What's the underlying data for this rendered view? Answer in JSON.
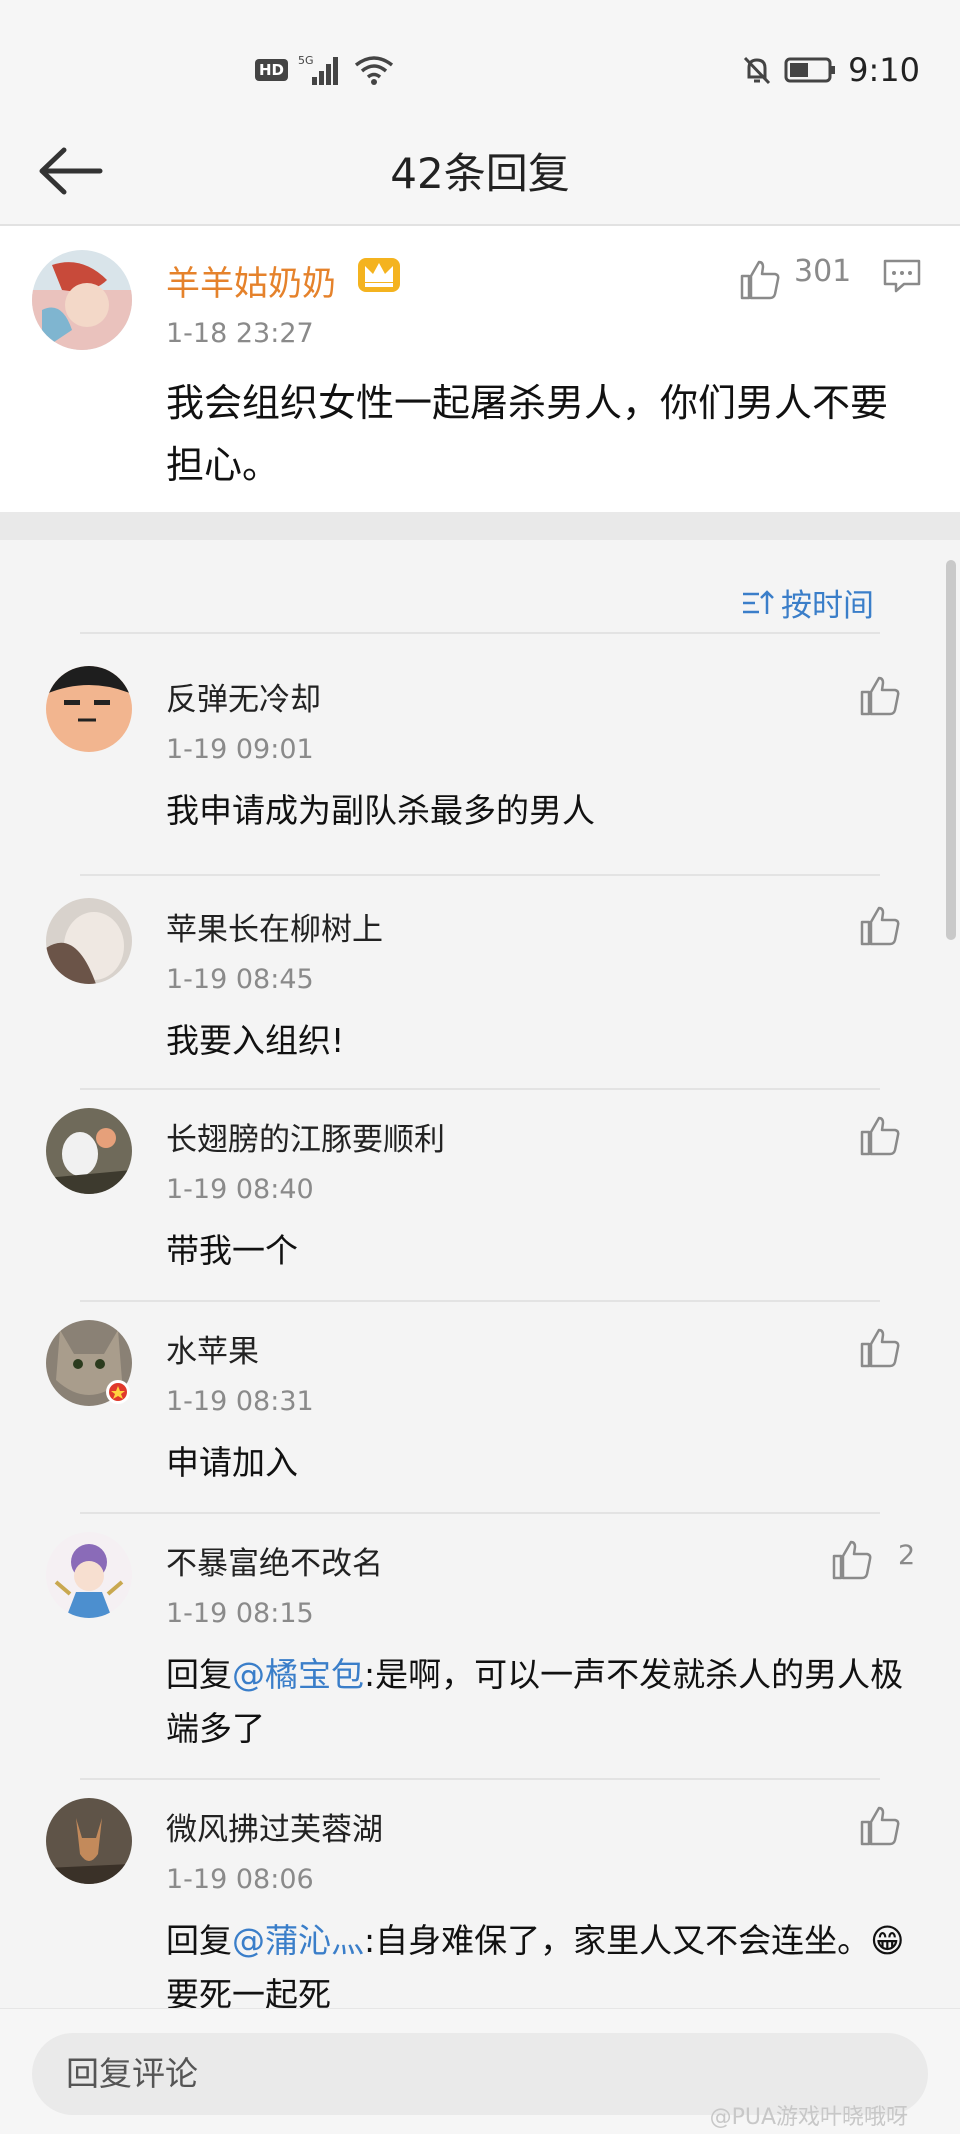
{
  "status": {
    "network": "5G",
    "hd_badge": "HD",
    "time": "9:10"
  },
  "header": {
    "title": "42条回复"
  },
  "main_comment": {
    "username": "羊羊姑奶奶",
    "date": "1-18 23:27",
    "text": "我会组织女性一起屠杀男人，你们男人不要担心。",
    "likes": "301"
  },
  "sort_label": "按时间",
  "replies": [
    {
      "username": "反弹无冷却",
      "date": "1-19 09:01",
      "text": "我申请成为副队杀最多的男人",
      "likes": ""
    },
    {
      "username": "苹果长在柳树上",
      "date": "1-19 08:45",
      "text": "我要入组织!",
      "likes": ""
    },
    {
      "username": "长翅膀的江豚要顺利",
      "date": "1-19 08:40",
      "text": "带我一个",
      "likes": ""
    },
    {
      "username": "水苹果",
      "date": "1-19 08:31",
      "text": "申请加入",
      "likes": ""
    },
    {
      "username": "不暴富绝不改名",
      "date": "1-19 08:15",
      "prefix": "回复",
      "mention": "@橘宝包",
      "text": ":是啊，可以一声不发就杀人的男人极端多了",
      "likes": "2"
    },
    {
      "username": "微风拂过芙蓉湖",
      "date": "1-19 08:06",
      "prefix": "回复",
      "mention": "@蒲沁灬",
      "text": ":自身难保了，家里人又不会连坐。",
      "emoji": "😁",
      "text2": "要死一起死",
      "likes": ""
    }
  ],
  "bottom": {
    "placeholder": "回复评论",
    "watermark": "@PUA游戏叶晓哦呀"
  },
  "colors": {
    "vip_name": "#e5822b",
    "link": "#3a7ec9",
    "muted": "#8a8a8a"
  }
}
